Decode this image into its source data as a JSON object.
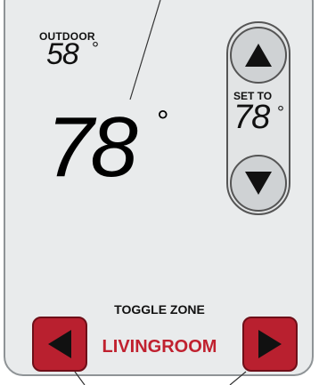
{
  "outdoor": {
    "label": "OUTDOOR",
    "temp": "58",
    "unit": "°"
  },
  "indoor": {
    "temp": "78",
    "unit": "°"
  },
  "setpoint": {
    "label": "SET TO",
    "temp": "78",
    "unit": "°",
    "up_icon": "triangle-up-icon",
    "down_icon": "triangle-down-icon"
  },
  "zone": {
    "label": "TOGGLE ZONE",
    "name": "LIVINGROOM",
    "prev_icon": "triangle-left-icon",
    "next_icon": "triangle-right-icon"
  },
  "colors": {
    "panel": "#e9ebec",
    "zone_button": "#b9202f",
    "zone_text": "#c0212f"
  }
}
